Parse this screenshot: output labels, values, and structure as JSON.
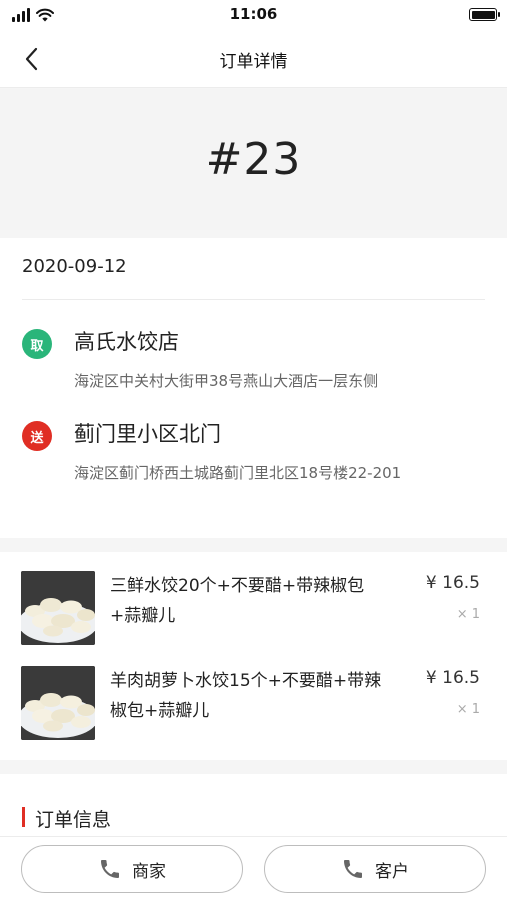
{
  "status_bar": {
    "time": "11:06"
  },
  "nav": {
    "title": "订单详情",
    "back_icon": "chevron-left-icon"
  },
  "order": {
    "number": "#23",
    "date": "2020-09-12"
  },
  "pickup": {
    "badge": "取",
    "badge_color": "#2ab57a",
    "name": "高氏水饺店",
    "address": "海淀区中关村大街甲38号燕山大酒店一层东侧"
  },
  "dropoff": {
    "badge": "送",
    "badge_color": "#e02e24",
    "name": "蓟门里小区北门",
    "address": "海淀区蓟门桥西土城路蓟门里北区18号楼22-201"
  },
  "items": [
    {
      "name": "三鲜水饺20个+不要醋+带辣椒包+蒜瓣儿",
      "price": "¥ 16.5",
      "qty": "× 1"
    },
    {
      "name": "羊肉胡萝卜水饺15个+不要醋+带辣椒包+蒜瓣儿",
      "price": "¥ 16.5",
      "qty": "× 1"
    }
  ],
  "sections": {
    "order_info_title": "订单信息"
  },
  "actions": {
    "merchant_label": "商家",
    "customer_label": "客户",
    "icon": "phone-icon"
  },
  "colors": {
    "accent": "#e02e24",
    "pickup": "#2ab57a",
    "dropoff": "#e02e24"
  }
}
